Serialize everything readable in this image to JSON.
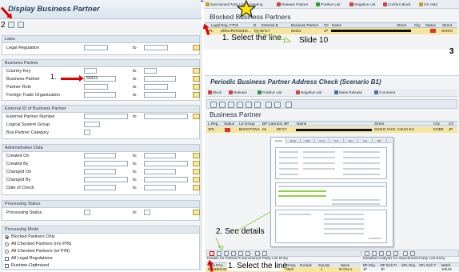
{
  "steps": {
    "left_marker": "2",
    "left_field_marker": "1.",
    "top_marker": "2",
    "select_line_top": "1. Select the line",
    "slide": "Slide 10",
    "right_marker": "3",
    "see_details": "2. See details",
    "select_line_bottom": "1. Select the line"
  },
  "left": {
    "title": "Display Business Partner",
    "sections": {
      "laws": {
        "header": "Laws",
        "rows": [
          {
            "label": "Legal Regulation",
            "value": ""
          }
        ]
      },
      "bp": {
        "header": "Business Partner",
        "rows": [
          {
            "label": "Country Key",
            "value": ""
          },
          {
            "label": "Business Partner",
            "value": "60323"
          },
          {
            "label": "Partner Role",
            "value": ""
          },
          {
            "label": "Foreign Trade Organization",
            "value": ""
          }
        ]
      },
      "ext": {
        "header": "External ID of Business Partner",
        "rows": [
          {
            "label": "External Partner Number",
            "value": ""
          },
          {
            "label": "Logical System Group",
            "value": ""
          },
          {
            "label": "Bus.Partner Category",
            "value": ""
          }
        ]
      },
      "admin": {
        "header": "Administrative Data",
        "rows": [
          {
            "label": "Created On",
            "value": ""
          },
          {
            "label": "Created By",
            "value": ""
          },
          {
            "label": "Changed On",
            "value": ""
          },
          {
            "label": "Changed By",
            "value": ""
          },
          {
            "label": "Date of Check",
            "value": ""
          }
        ]
      },
      "status": {
        "header": "Processing Status",
        "rows": [
          {
            "label": "Processing Status",
            "value": ""
          }
        ]
      },
      "mode": {
        "header": "Processing Mode",
        "options": [
          "Blocked Partners Only",
          "All Checked Partners (n/o P/N)",
          "All Checked Partners (w/ P/N)",
          "All Legal Regulations",
          "Runtime-Optimized"
        ]
      }
    },
    "to_label": "to"
  },
  "blocked": {
    "toolbar": [
      "Sanctioned Party List Screening",
      "Release Partner",
      "Positive List",
      "Negative List",
      "Confirm Block",
      "On Hold"
    ],
    "title": "Blocked Business Partners",
    "columns": [
      "Legal Reg.",
      "FTOs",
      "B.",
      "External B",
      "Business Partner",
      "Ctr",
      "Name",
      "Street",
      "City",
      "Status",
      "Street"
    ],
    "row": [
      "SPL",
      "ZRKL/RVKS01/K...",
      "E0-85717",
      "60323",
      "JP",
      "SHIKO"
    ]
  },
  "periodic": {
    "title": "Periodic Business Partner Address Check (Scenario B1)",
    "toolbar": [
      "Block",
      "Release",
      "Positive List",
      "Negative List",
      "Mass Release",
      "Comment"
    ],
    "bp_title": "Business Partner",
    "columns": [
      "L.Reg.",
      "Status",
      "LS Group",
      "BP Cate.",
      "Ext. BP",
      "Name",
      "Street",
      "City",
      "Ctr"
    ],
    "row": [
      "SPL",
      "",
      "BHOGTSNA",
      "02",
      "85717",
      "",
      "SHIKO-CHO, CHUO-KU",
      "KOBE",
      "JP"
    ]
  },
  "embedded": {
    "tabs": [
      "Details",
      "Reqs",
      "Addr",
      "Cont",
      "Text",
      "Doc",
      "Log",
      "BP"
    ]
  },
  "sanctioned": {
    "title": "Details for Partner's Sanctioned Party List Entry",
    "columns": [
      "Data Prov.",
      "List",
      "SPL Number",
      "SPL Cat.",
      "Group",
      "Exclude",
      "Seq.No.",
      "Name"
    ],
    "rows": [
      [
        "BUNDESANZE",
        "DPLIEU",
        "69440",
        "",
        "NKO",
        "",
        "1",
        "Ri Che-s"
      ],
      [
        "",
        "",
        "",
        "",
        "NKO",
        "",
        "2",
        "Ri Je-so"
      ],
      [
        "",
        "",
        "",
        "",
        "NKO",
        "",
        "1",
        ""
      ]
    ]
  },
  "analysis": {
    "title": "Detailed Analysis for Sanctioned Party List Entry",
    "columns": [
      "BP Orig.",
      "BP Srch Tr",
      "SPL Orig.",
      "SPL Srch T",
      "Match"
    ],
    "rows": [
      [
        "JP",
        "JP",
        "",
        "",
        "100,00"
      ],
      [
        "CHEM",
        "CHEM",
        "Che",
        "CHE",
        "75,00"
      ]
    ]
  },
  "colors": {
    "accent_red": "#e00000",
    "selected_row": "#f6e59c",
    "header_blue": "#27415a",
    "panel_bg": "#f2f4f6"
  }
}
